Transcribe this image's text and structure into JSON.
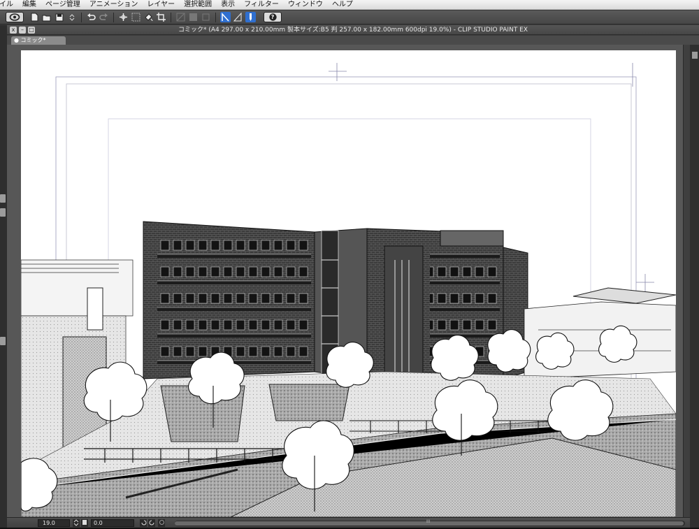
{
  "menu": {
    "items": [
      "イル",
      "編集",
      "ページ管理",
      "アニメーション",
      "レイヤー",
      "選択範囲",
      "表示",
      "フィルター",
      "ウィンドウ",
      "ヘルプ"
    ]
  },
  "toolbar": {
    "logo_icon": "clip-studio-logo-icon",
    "help_label": "?",
    "icons": [
      "new-file-icon",
      "open-file-icon",
      "save-icon",
      "undo-icon",
      "redo-icon",
      "transform-icon",
      "fill-icon",
      "ruler-snap-icon",
      "perspective-snap-icon",
      "pen-icon"
    ]
  },
  "window": {
    "title": "コミック* (A4 297.00 x 210.00mm 製本サイズ:B5 判 257.00 x 182.00mm 600dpi 19.0%)  - CLIP STUDIO PAINT EX",
    "controls": [
      "x",
      "–",
      "□"
    ]
  },
  "document_tab": {
    "label": "● コミック*"
  },
  "statusbar": {
    "zoom_value": "19.0",
    "angle_value": "0.0",
    "scroll_marker": "III"
  },
  "colors": {
    "menu_bg": "#e6e6e6",
    "toolbar_bg": "#4e4e4e",
    "canvas_bg": "#575757",
    "paper": "#ffffff",
    "guide_line": "#7777aa"
  }
}
